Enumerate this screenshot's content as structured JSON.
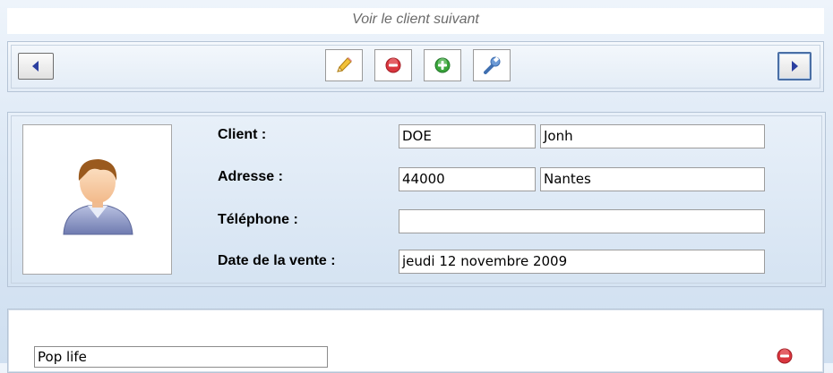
{
  "caption": "Voir le client suivant",
  "toolbar": {
    "prev_icon": "arrow-left-icon",
    "next_icon": "arrow-right-icon",
    "edit_icon": "pencil-icon",
    "delete_icon": "remove-icon",
    "add_icon": "add-icon",
    "settings_icon": "wrench-icon"
  },
  "client": {
    "photo_icon": "user-avatar-icon",
    "labels": {
      "client": "Client :",
      "address": "Adresse :",
      "phone": "Téléphone :",
      "sale_date": "Date de la vente :"
    },
    "last_name": "DOE",
    "first_name": "Jonh",
    "postal_code": "44000",
    "city": "Nantes",
    "phone": "",
    "sale_date": "jeudi 12 novembre 2009"
  },
  "items": [
    {
      "title": "Pop life",
      "delete_icon": "remove-icon"
    }
  ],
  "colors": {
    "accent_blue": "#2b3fa0",
    "delete_red": "#d9363e",
    "add_green": "#3aa53a"
  }
}
